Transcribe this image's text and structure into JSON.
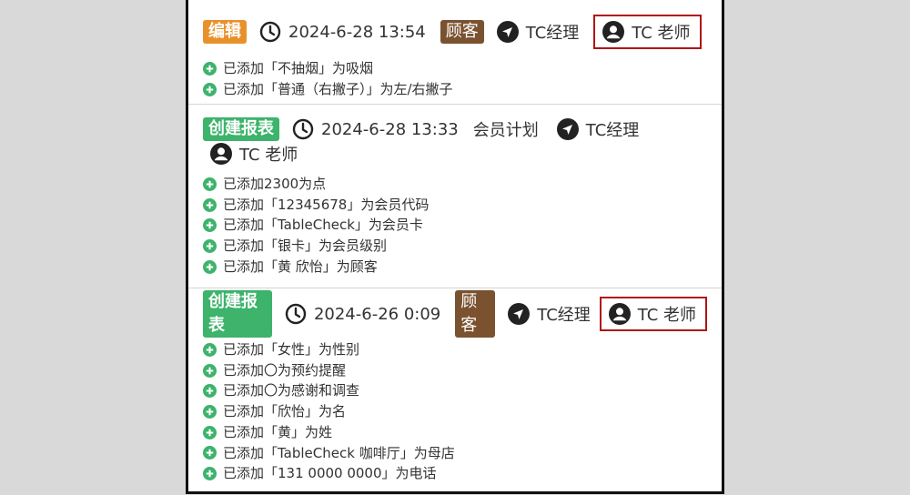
{
  "entries": [
    {
      "badge": "编辑",
      "time": "2024-6-28 13:54",
      "customer": "顾客",
      "manager": "TC经理",
      "user": "TC 老师",
      "changes": [
        "已添加「不抽烟」为吸烟",
        "已添加「普通（右撇子）」为左/右撇子"
      ]
    },
    {
      "badge": "创建报表",
      "time": "2024-6-28 13:33",
      "plan": "会员计划",
      "manager": "TC经理",
      "user": "TC 老师",
      "changes": [
        "已添加2300为点",
        "已添加「12345678」为会员代码",
        "已添加「TableCheck」为会员卡",
        "已添加「银卡」为会员级别",
        "已添加「黄 欣怡」为顾客"
      ]
    },
    {
      "badge": "创建报表",
      "time": "2024-6-26 0:09",
      "customer": "顾客",
      "manager": "TC经理",
      "user": "TC 老师",
      "changes": [
        "已添加「女性」为性别",
        "已添加〇为预约提醒",
        "已添加〇为感谢和调查",
        "已添加「欣怡」为名",
        "已添加「黄」为姓",
        "已添加「TableCheck 咖啡厅」为母店",
        "已添加「131 0000 0000」为电话"
      ]
    }
  ],
  "colors": {
    "edit_badge": "#e8912c",
    "create_badge": "#3db36b",
    "customer_badge": "#7a5230",
    "plus": "#3db36b",
    "highlight": "#b01414"
  }
}
